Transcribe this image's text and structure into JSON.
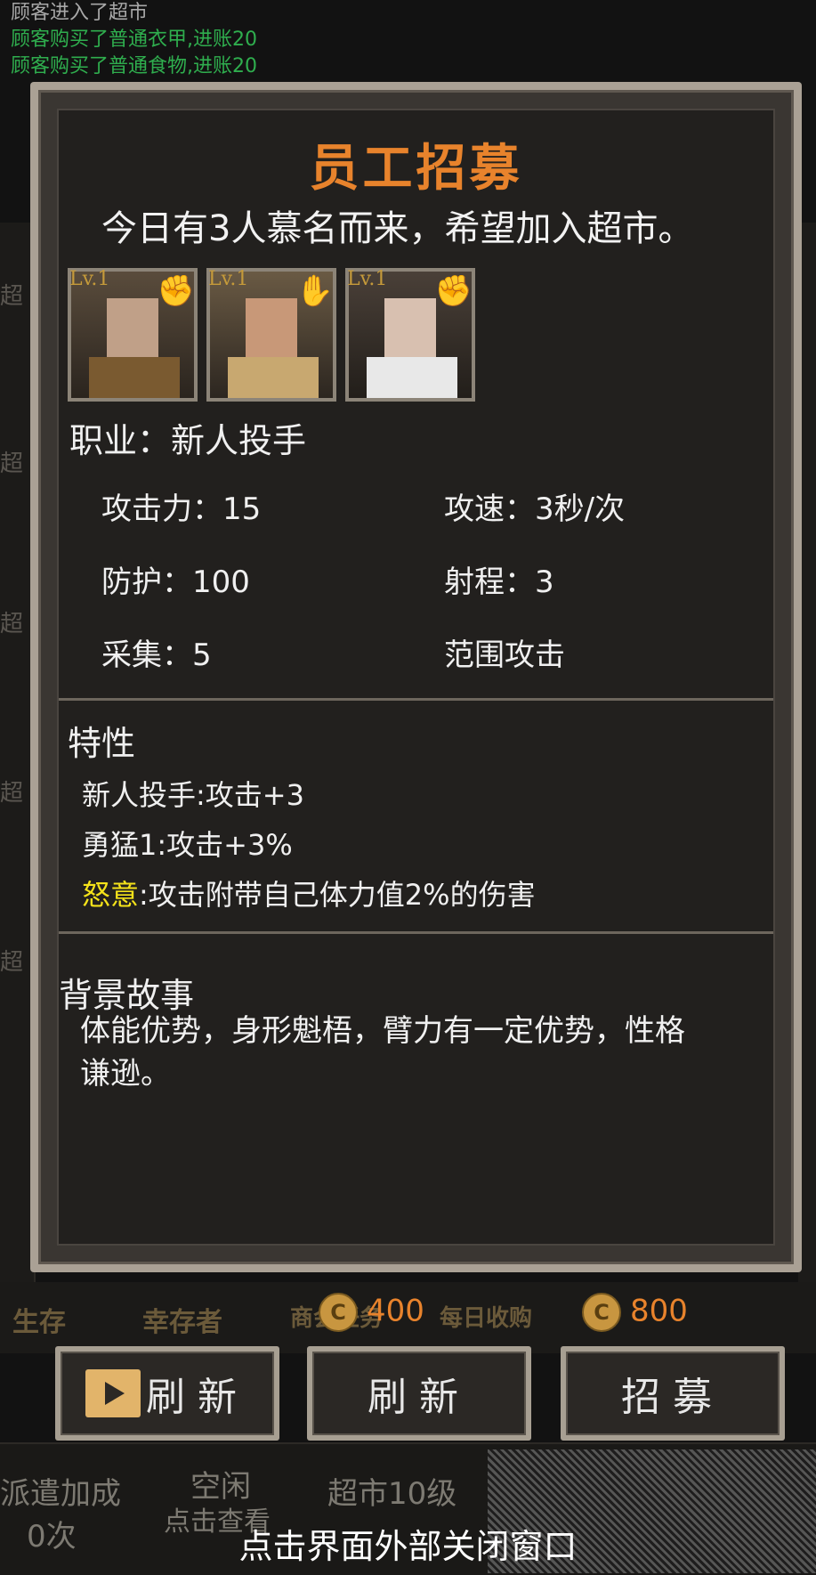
{
  "log": [
    {
      "text": "顾客进入了超市",
      "color": "#a8a8a8"
    },
    {
      "text": "顾客购买了普通衣甲,进账20",
      "color": "#2fae4e"
    },
    {
      "text": "顾客购买了普通食物,进账20",
      "color": "#2fae4e"
    }
  ],
  "background": {
    "side_labels": [
      "超",
      "超",
      "超",
      "超",
      "超"
    ],
    "bar_labels": [
      "生存",
      "幸存者",
      "商会任务",
      "每日收购"
    ],
    "bottom_labels": [
      "派遣加成",
      "0次",
      "空闲",
      "点击查看",
      "超市10级"
    ]
  },
  "dialog": {
    "title": "员工招募",
    "intro": "今日有3人慕名而来，希望加入超市。",
    "candidates": [
      {
        "level": "Lv.1",
        "role_icon": "blue-gauntlet-icon",
        "icon_color": "#2f8de0"
      },
      {
        "level": "Lv.1",
        "role_icon": "green-glove-icon",
        "icon_color": "#4dd23a"
      },
      {
        "level": "Lv.1",
        "role_icon": "blue-gauntlet-icon",
        "icon_color": "#2f8de0"
      }
    ],
    "job": "职业：新人投手",
    "stats": {
      "attack": "攻击力：15",
      "speed": "攻速：3秒/次",
      "defense": "防护：100",
      "range": "射程：3",
      "gather": "采集：5",
      "aoe": "范围攻击"
    },
    "traits_title": "特性",
    "traits": {
      "t1": "新人投手:攻击+3",
      "t2": "勇猛1:攻击+3%",
      "t3_highlight": "怒意",
      "t3_rest": ":攻击附带自己体力值2%的伤害"
    },
    "story_title": "背景故事",
    "story_text": "体能优势，身形魁梧，臂力有一定优势，性格谦逊。"
  },
  "costs": {
    "refresh": "400",
    "recruit": "800"
  },
  "buttons": {
    "ad_refresh": "刷新",
    "refresh": "刷新",
    "recruit": "招募"
  },
  "close_hint": "点击界面外部关闭窗口"
}
